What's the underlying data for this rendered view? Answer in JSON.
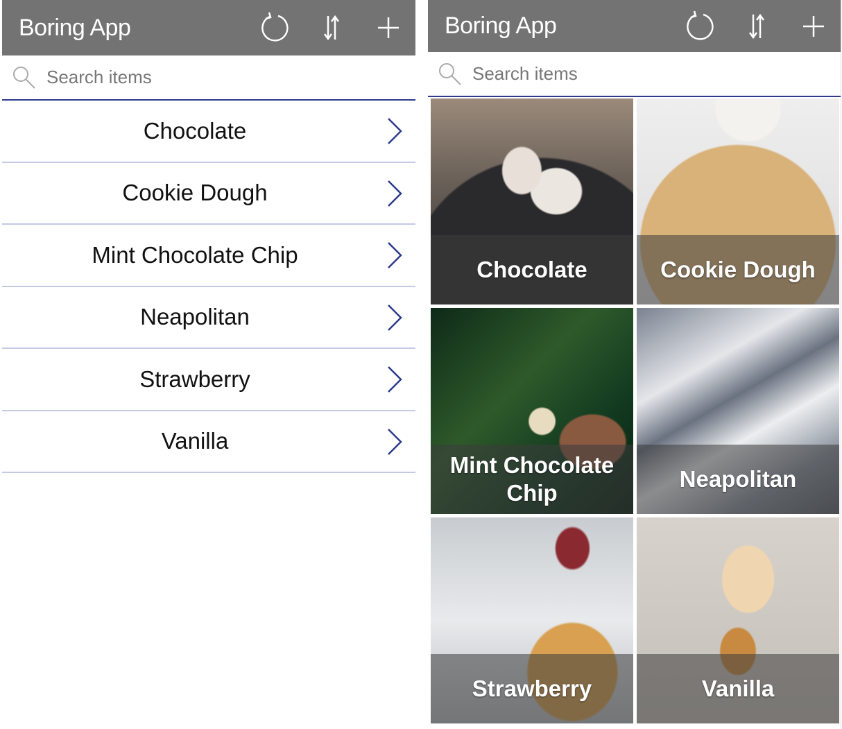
{
  "app": {
    "title": "Boring App",
    "icons": [
      "refresh-icon",
      "sort-icon",
      "add-icon"
    ]
  },
  "search": {
    "placeholder": "Search items"
  },
  "items": [
    {
      "label": "Chocolate"
    },
    {
      "label": "Cookie Dough"
    },
    {
      "label": "Mint Chocolate Chip"
    },
    {
      "label": "Neapolitan"
    },
    {
      "label": "Strawberry"
    },
    {
      "label": "Vanilla"
    }
  ],
  "colors": {
    "header": "#737373",
    "accent": "#2b3a8c",
    "divider": "#c5c9e4"
  }
}
